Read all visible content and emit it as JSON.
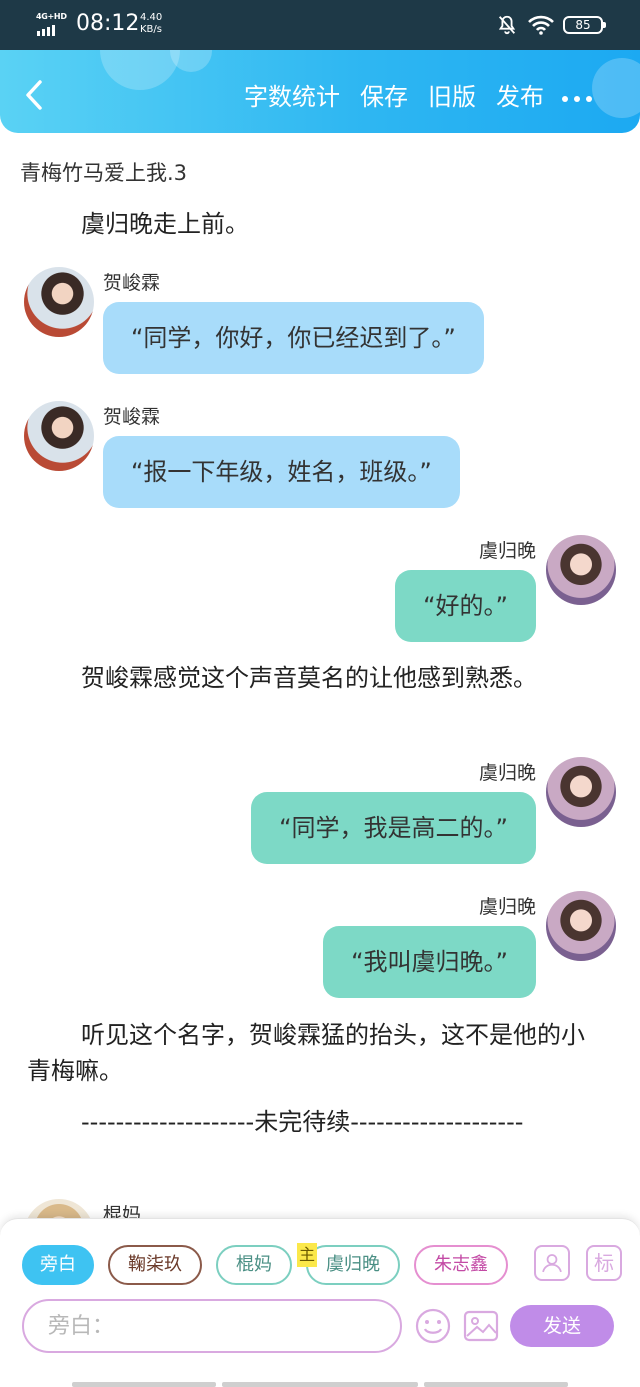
{
  "status_bar": {
    "network": "4G+HD",
    "time": "08:12",
    "speed_value": "4.40",
    "speed_unit": "KB/s",
    "battery": "85"
  },
  "header": {
    "back_icon": "chevron-left-icon",
    "actions": [
      "字数统计",
      "保存",
      "旧版",
      "发布"
    ],
    "more_icon": "more-dots-icon"
  },
  "document": {
    "title": "青梅竹马爱上我.3"
  },
  "feed": {
    "narration_1": "虞归晚走上前。",
    "msg_1": {
      "name": "贺峻霖",
      "text": "“同学，你好，你已经迟到了。”"
    },
    "msg_2": {
      "name": "贺峻霖",
      "text": "“报一下年级，姓名，班级。”"
    },
    "msg_3": {
      "name": "虞归晚",
      "text": "“好的。”"
    },
    "narration_2": "贺峻霖感觉这个声音莫名的让他感到熟悉。",
    "msg_4": {
      "name": "虞归晚",
      "text": "“同学，我是高二的。”"
    },
    "msg_5": {
      "name": "虞归晚",
      "text": "“我叫虞归晚。”"
    },
    "narration_3": "听见这个名字，贺峻霖猛的抬头，这不是他的小青梅嘛。",
    "narration_4": "--------------------未完待续--------------------",
    "msg_6_name": "棍妈"
  },
  "composer": {
    "chips": [
      "旁白",
      "鞠柒玖",
      "棍妈",
      "虞归晚",
      "朱志鑫"
    ],
    "main_tag": "主",
    "icon_right_1": "add-person-icon",
    "icon_right_2": "标",
    "input_placeholder": "旁白：",
    "emoji_icon": "smiley-icon",
    "image_icon": "image-icon",
    "send_label": "发送"
  },
  "colors": {
    "header_start": "#5ad2f4",
    "header_end": "#1ca9f2",
    "left_bubble": "#a8dcfa",
    "right_bubble": "#7dd9c6",
    "send_button": "#c08ce8",
    "active_chip": "#3ec3f2"
  }
}
